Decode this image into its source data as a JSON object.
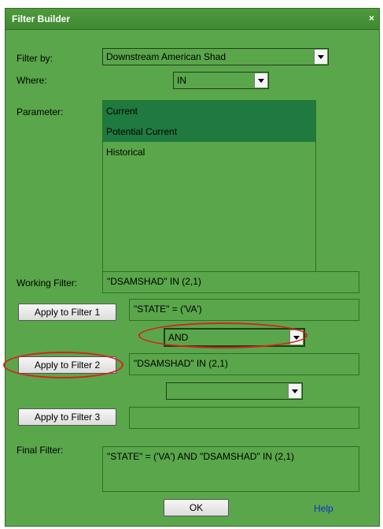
{
  "dialog": {
    "title": "Filter Builder",
    "close_label": "×"
  },
  "filter_by": {
    "label": "Filter by:",
    "value": "Downstream American Shad"
  },
  "where": {
    "label": "Where:",
    "value": "IN"
  },
  "parameter": {
    "label": "Parameter:",
    "options": [
      {
        "label": "Current",
        "selected": true
      },
      {
        "label": "Potential Current",
        "selected": true
      },
      {
        "label": "Historical",
        "selected": false
      }
    ]
  },
  "working_filter": {
    "label": "Working Filter:",
    "value": "\"DSAMSHAD\" IN (2,1)"
  },
  "filter1": {
    "button": "Apply to Filter 1",
    "value": "\"STATE\" = ('VA')"
  },
  "operator1": {
    "value": "AND"
  },
  "filter2": {
    "button": "Apply to Filter 2",
    "value": "\"DSAMSHAD\" IN (2,1)"
  },
  "operator2": {
    "value": ""
  },
  "filter3": {
    "button": "Apply to Filter 3",
    "value": ""
  },
  "final_filter": {
    "label": "Final Filter:",
    "value": "\"STATE\" = ('VA') AND \"DSAMSHAD\" IN (2,1)"
  },
  "footer": {
    "ok_label": "OK",
    "help_label": "Help"
  },
  "icons": {
    "dropdown": "chevron-down-icon"
  },
  "colors": {
    "panel": "#5aa64b",
    "selection": "#1f7a3f",
    "highlight_ring": "#d92020",
    "link": "#0f2fcc"
  }
}
